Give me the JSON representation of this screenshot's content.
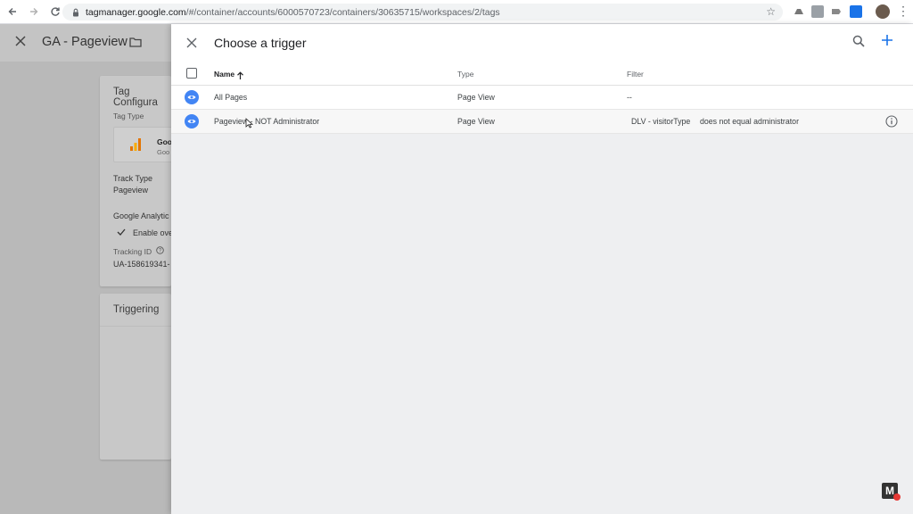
{
  "browser": {
    "url_host": "tagmanager.google.com",
    "url_path": "/#/container/accounts/6000570723/containers/30635715/workspaces/2/tags"
  },
  "background": {
    "title": "GA - Pageview",
    "card1": {
      "heading": "Tag Configura",
      "tag_type_label": "Tag Type",
      "tag_type_name": "Goo",
      "tag_type_sub": "Goo",
      "track_type_label": "Track Type",
      "track_type_value": "Pageview",
      "ga_settings_label": "Google Analytic",
      "enable_override": "Enable ove",
      "tracking_id_label": "Tracking ID",
      "tracking_id_value": "UA-158619341-"
    },
    "card2": {
      "heading": "Triggering"
    }
  },
  "panel": {
    "title": "Choose a trigger",
    "columns": {
      "name": "Name",
      "type": "Type",
      "filter": "Filter"
    },
    "rows": [
      {
        "name": "All Pages",
        "type": "Page View",
        "filter": "--"
      },
      {
        "name": "Pageview - NOT Administrator",
        "type": "Page View",
        "filter_variable": "DLV - visitorType",
        "filter_condition": "does not equal administrator"
      }
    ]
  },
  "watermark": "M",
  "colors": {
    "accent": "#4285f4",
    "panel_bg": "#eeeff1"
  },
  "icons": [
    "close-icon",
    "folder-icon",
    "search-icon",
    "add-icon",
    "sort-arrow-up-icon",
    "eye-icon",
    "info-icon"
  ]
}
